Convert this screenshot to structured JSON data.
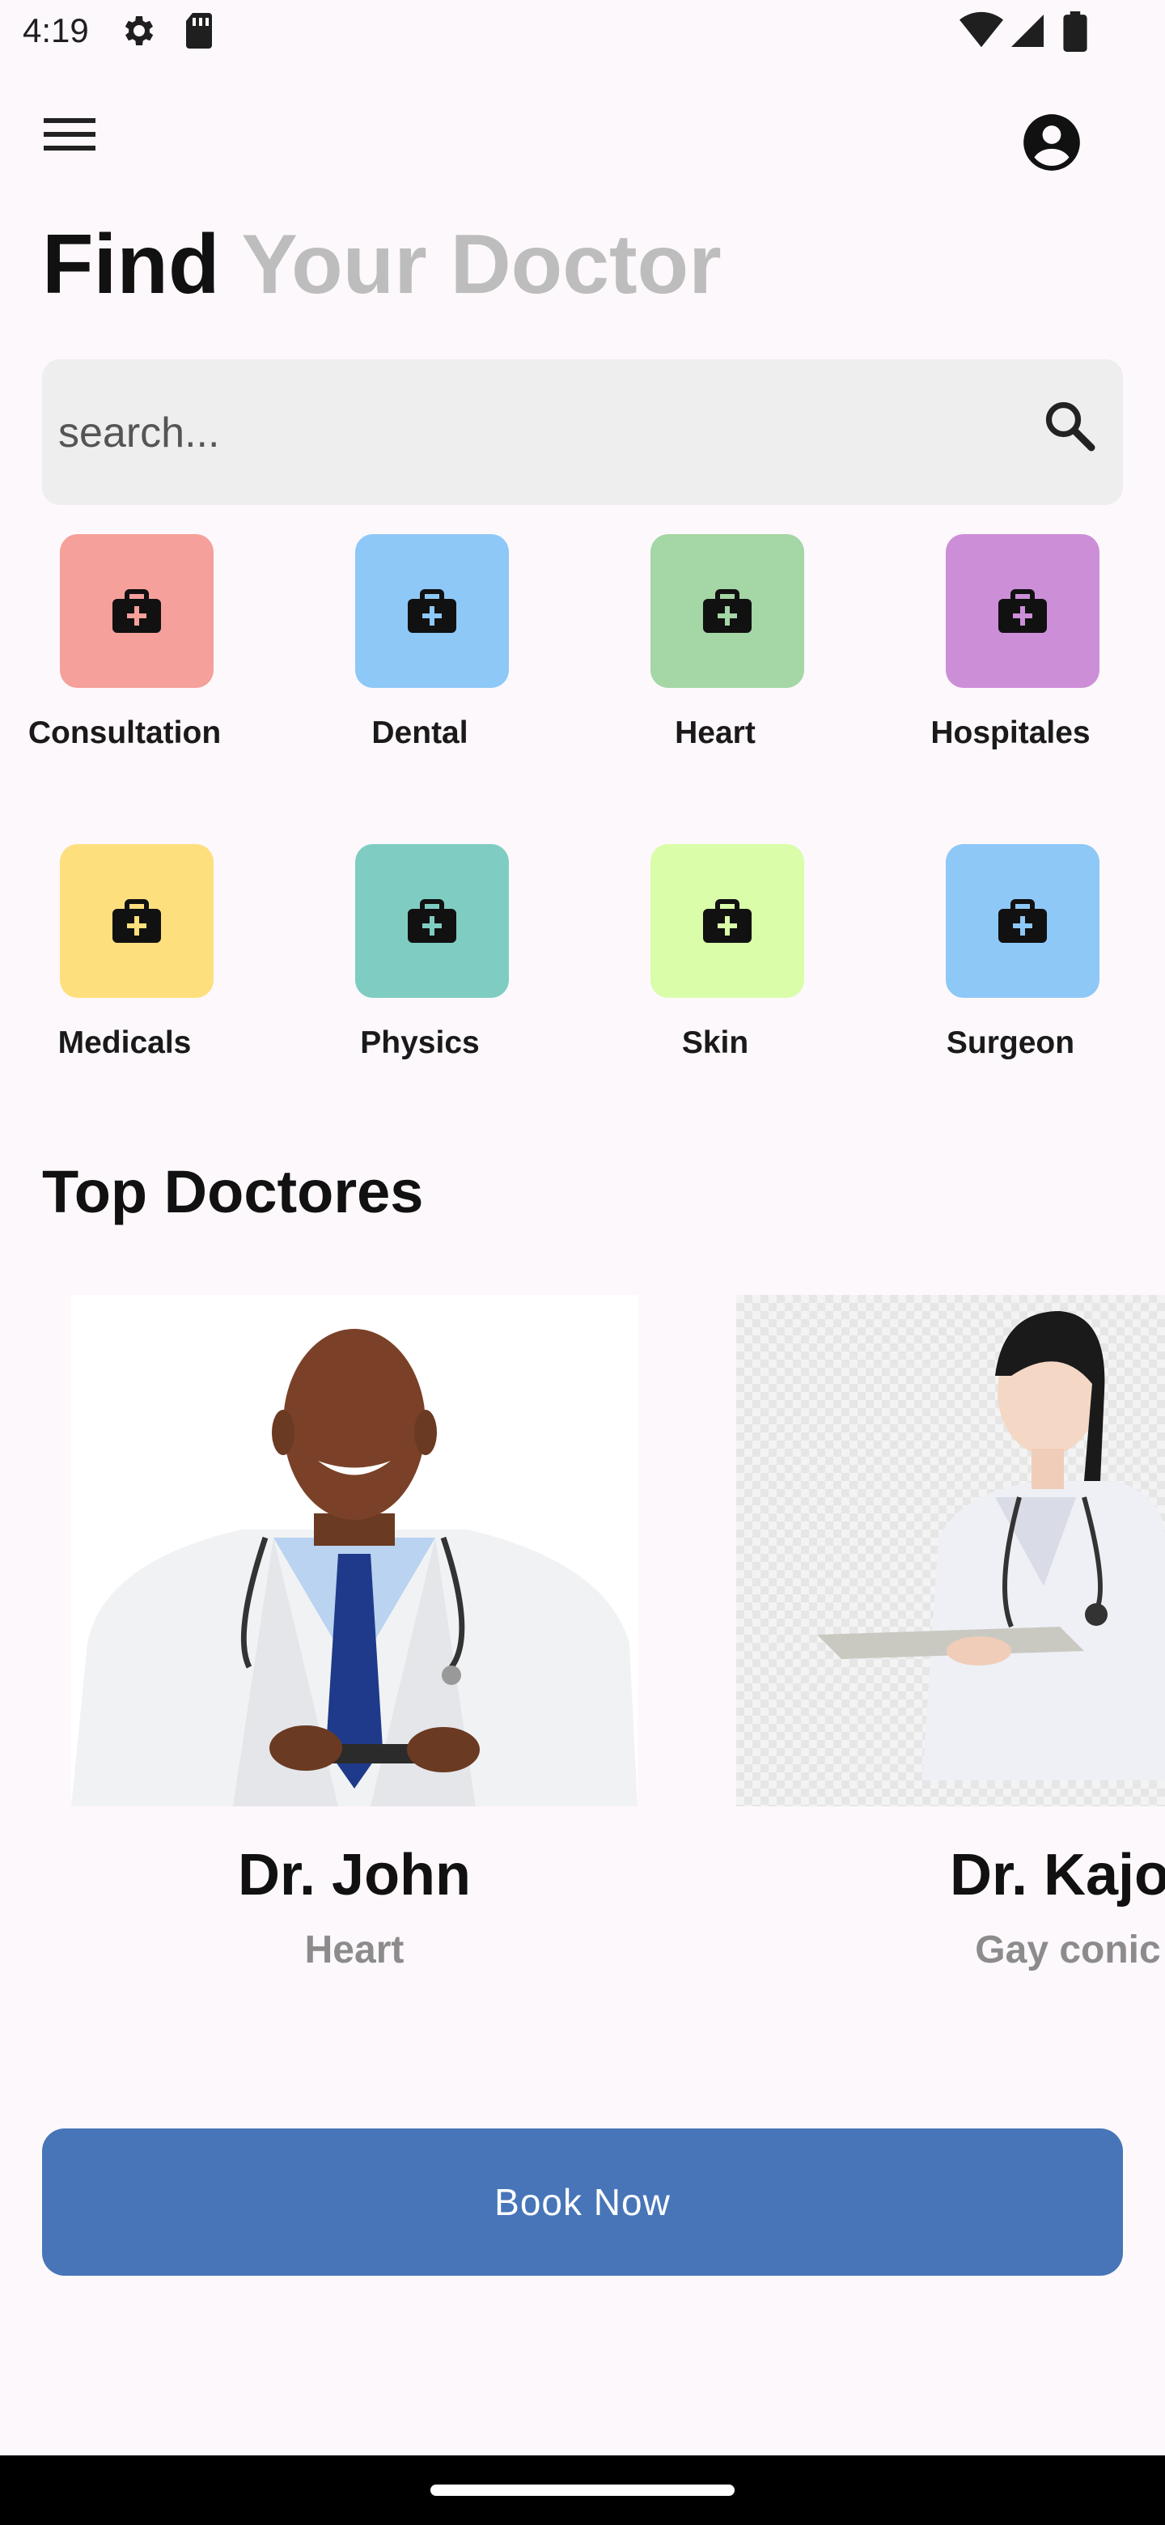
{
  "status_bar": {
    "time": "4:19",
    "icons": [
      "gear-icon",
      "sim-card-icon",
      "wifi-icon",
      "cellular-signal-icon",
      "battery-icon"
    ]
  },
  "app_bar": {
    "menu_icon": "hamburger-menu-icon",
    "profile_icon": "account-circle-icon"
  },
  "headline": {
    "part1": "Find",
    "part2": "Your Doctor"
  },
  "search": {
    "placeholder": "search...",
    "icon": "search-icon"
  },
  "categories": [
    {
      "label": "Consultation",
      "color": "#f5a09a"
    },
    {
      "label": "Dental",
      "color": "#8ec8f7"
    },
    {
      "label": "Heart",
      "color": "#a4d6a6"
    },
    {
      "label": "Hospitales",
      "color": "#cd8ed8"
    },
    {
      "label": "Medicals",
      "color": "#fedf7e"
    },
    {
      "label": "Physics",
      "color": "#7fcdc2"
    },
    {
      "label": "Skin",
      "color": "#dafda9"
    },
    {
      "label": "Surgeon",
      "color": "#8ec8f7"
    }
  ],
  "section_title": "Top Doctores",
  "doctors": [
    {
      "name": "Dr. John",
      "specialty": "Heart"
    },
    {
      "name": "Dr. Kajol",
      "specialty": "Gay conic"
    }
  ],
  "book_button": "Book Now",
  "colors": {
    "background": "#fdf8fb",
    "primary": "#4775b8",
    "headline_muted": "#bdbdbd"
  }
}
